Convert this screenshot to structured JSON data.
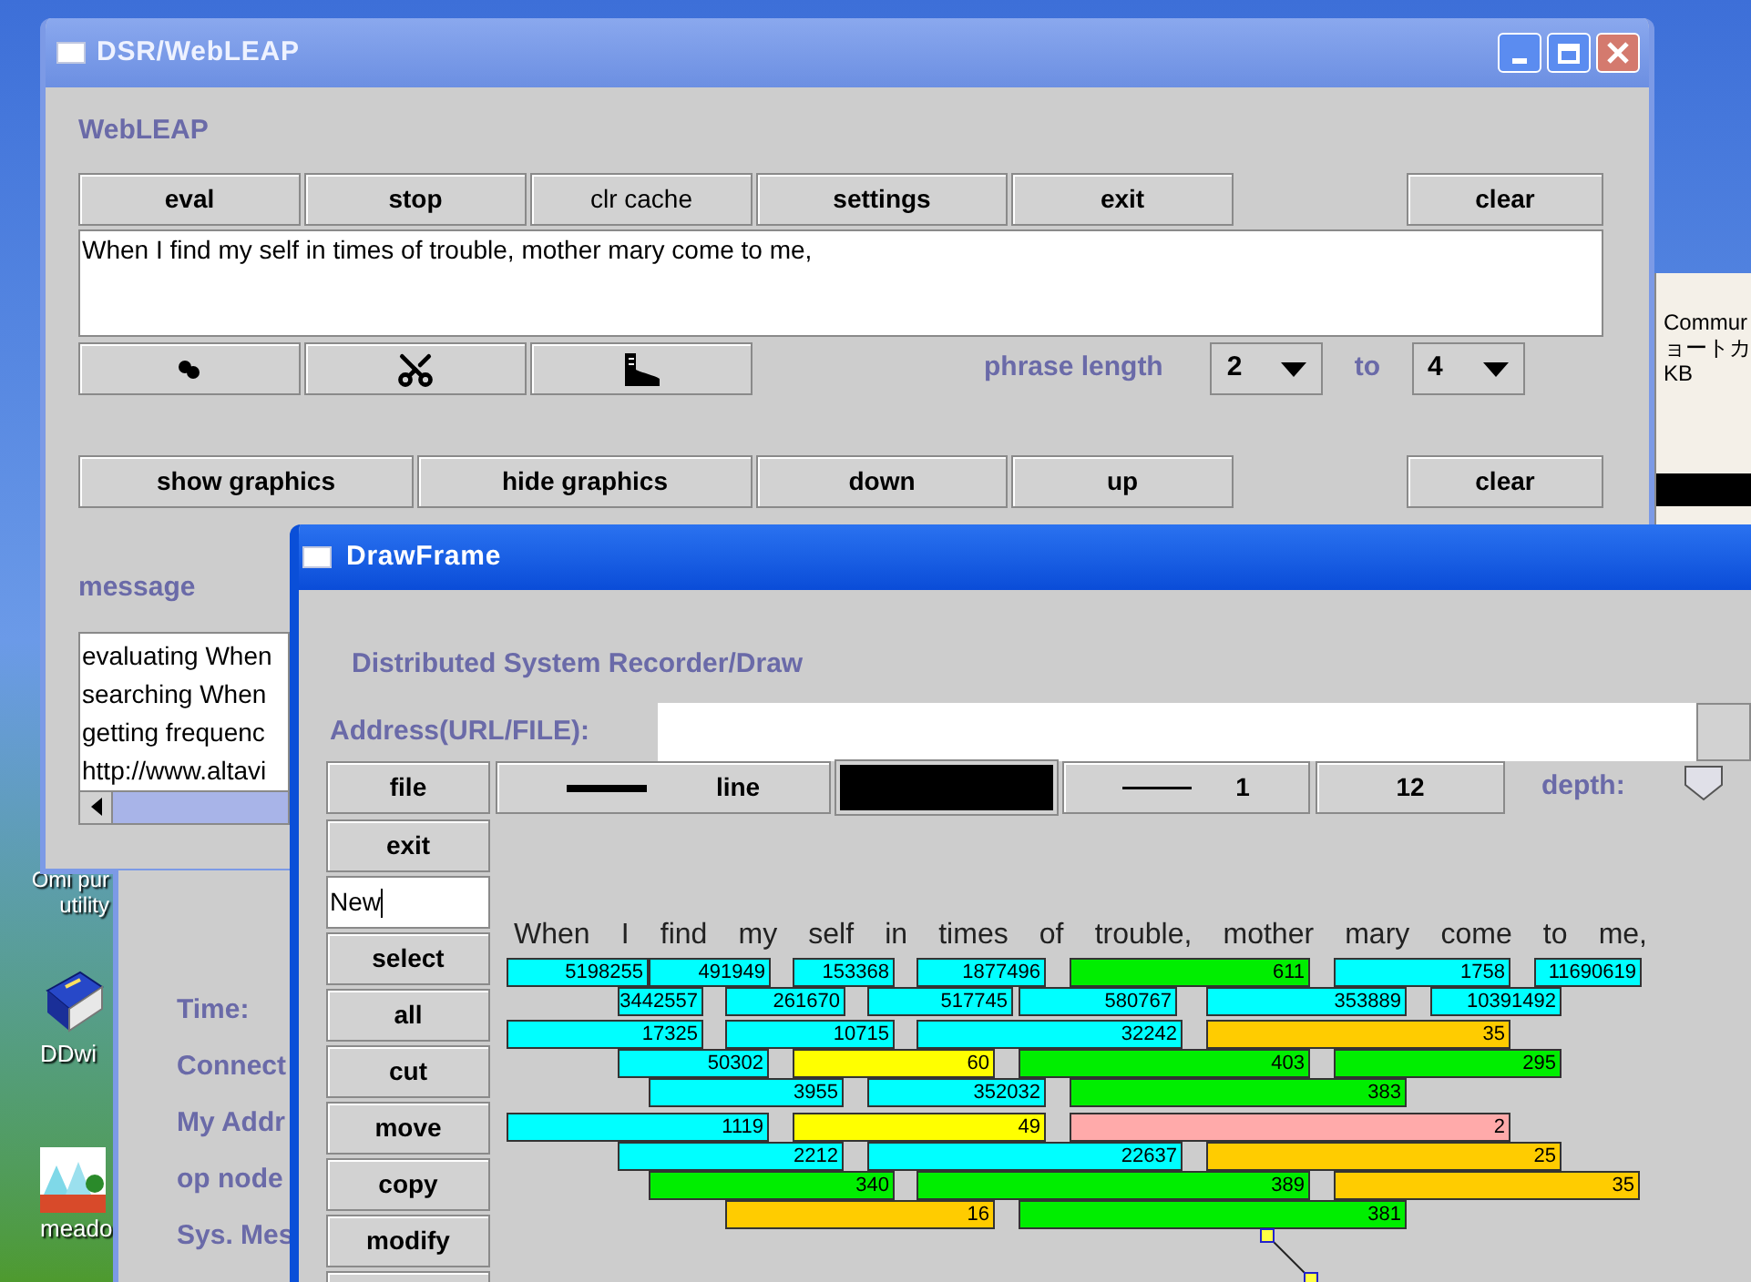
{
  "desktop": {
    "icons": [
      {
        "label": "DDwi",
        "kind": "book"
      },
      {
        "label": "meado",
        "kind": "meadow"
      }
    ],
    "cut_label": [
      "Omi pur",
      "utility"
    ]
  },
  "back_window": {
    "lines": [
      "Commur",
      "ョートカ",
      "KB"
    ]
  },
  "main_window": {
    "title": "DSR/WebLEAP",
    "heading": "WebLEAP",
    "top_buttons": [
      {
        "label": "eval",
        "bold": true
      },
      {
        "label": "stop",
        "bold": true
      },
      {
        "label": "clr cache",
        "bold": false
      },
      {
        "label": "settings",
        "bold": true
      },
      {
        "label": "exit",
        "bold": true
      }
    ],
    "clear_top": "clear",
    "query": "When I find my self in times of trouble, mother mary come to me,",
    "phrase_length": {
      "label": "phrase length",
      "from": "2",
      "to_label": "to",
      "to": "4"
    },
    "graphics_buttons": [
      "show graphics",
      "hide graphics",
      "down",
      "up"
    ],
    "clear_bottom": "clear",
    "message_label": "message",
    "messages": [
      "evaluating When",
      "searching When",
      "getting frequenc",
      "http://www.altavi"
    ]
  },
  "status_window": {
    "labels": [
      "Time:",
      "Connect",
      "My Addr",
      "op node",
      "Sys. Mes"
    ]
  },
  "draw_frame": {
    "title": "DrawFrame",
    "heading": "Distributed System Recorder/Draw",
    "address_label": "Address(URL/FILE):",
    "file_button": "file",
    "line_button": "line",
    "width_button": "1",
    "size_button": "12",
    "depth_label": "depth:",
    "side_buttons": [
      "exit",
      "select",
      "all",
      "cut",
      "move",
      "copy",
      "modify"
    ],
    "name_field": "New",
    "sentence": "When I find my self in times of trouble, mother mary come to me,",
    "bar_rows": [
      [
        {
          "label": "5198255",
          "color": "#00ffff"
        },
        {
          "label": "491949",
          "color": "#00ffff"
        },
        {
          "label": "153368",
          "color": "#00ffff"
        },
        {
          "label": "1877496",
          "color": "#00ffff"
        },
        {
          "label": "611",
          "color": "#00ee00"
        },
        {
          "label": "1758",
          "color": "#00ffff"
        },
        {
          "label": "11690619",
          "color": "#00ffff"
        }
      ],
      [
        {
          "label": "3442557",
          "color": "#00ffff"
        },
        {
          "label": "261670",
          "color": "#00ffff"
        },
        {
          "label": "517745",
          "color": "#00ffff"
        },
        {
          "label": "580767",
          "color": "#00ffff"
        },
        {
          "label": "353889",
          "color": "#00ffff"
        },
        {
          "label": "10391492",
          "color": "#00ffff"
        }
      ],
      [
        {
          "label": "17325",
          "color": "#00ffff"
        },
        {
          "label": "10715",
          "color": "#00ffff"
        },
        {
          "label": "32242",
          "color": "#00ffff"
        },
        {
          "label": "35",
          "color": "#ffcc00"
        }
      ],
      [
        {
          "label": "50302",
          "color": "#00ffff"
        },
        {
          "label": "60",
          "color": "#ffff00"
        },
        {
          "label": "403",
          "color": "#00ee00"
        },
        {
          "label": "295",
          "color": "#00ee00"
        }
      ],
      [
        {
          "label": "3955",
          "color": "#00ffff"
        },
        {
          "label": "352032",
          "color": "#00ffff"
        },
        {
          "label": "383",
          "color": "#00ee00"
        }
      ],
      [
        {
          "label": "1119",
          "color": "#00ffff"
        },
        {
          "label": "49",
          "color": "#ffff00"
        },
        {
          "label": "2",
          "color": "#ffaaaa"
        }
      ],
      [
        {
          "label": "2212",
          "color": "#00ffff"
        },
        {
          "label": "22637",
          "color": "#00ffff"
        },
        {
          "label": "25",
          "color": "#ffcc00"
        }
      ],
      [
        {
          "label": "340",
          "color": "#00ee00"
        },
        {
          "label": "389",
          "color": "#00ee00"
        },
        {
          "label": "35",
          "color": "#ffcc00"
        }
      ],
      [
        {
          "label": "16",
          "color": "#ffcc00"
        },
        {
          "label": "381",
          "color": "#00ee00"
        }
      ]
    ]
  }
}
